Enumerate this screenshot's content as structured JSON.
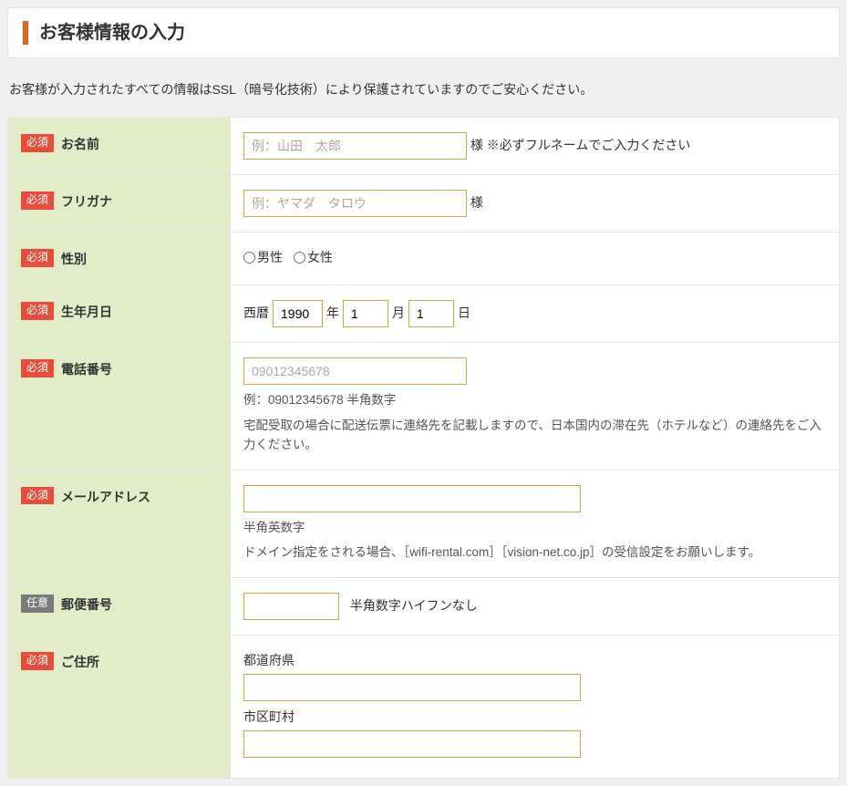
{
  "header": {
    "title": "お客様情報の入力"
  },
  "ssl_notice": "お客様が入力されたすべての情報はSSL（暗号化技術）により保護されていますのでご安心ください。",
  "badges": {
    "required": "必須",
    "optional": "任意"
  },
  "fields": {
    "name": {
      "label": "お名前",
      "placeholder": "例：山田　太郎",
      "suffix": "様 ※必ずフルネームでご入力ください"
    },
    "furigana": {
      "label": "フリガナ",
      "placeholder": "例：ヤマダ　タロウ",
      "suffix": "様"
    },
    "gender": {
      "label": "性別",
      "male": "男性",
      "female": "女性"
    },
    "birth": {
      "label": "生年月日",
      "prefix": "西暦",
      "year": "1990",
      "year_suffix": "年",
      "month": "1",
      "month_suffix": "月",
      "day": "1",
      "day_suffix": "日"
    },
    "phone": {
      "label": "電話番号",
      "placeholder": "09012345678",
      "help1": "例：09012345678 半角数字",
      "help2": "宅配受取の場合に配送伝票に連絡先を記載しますので、日本国内の滞在先（ホテルなど）の連絡先をご入力ください。"
    },
    "email": {
      "label": "メールアドレス",
      "help1": "半角英数字",
      "help2": "ドメイン指定をされる場合、［wifi-rental.com］［vision-net.co.jp］の受信設定をお願いします。"
    },
    "postal": {
      "label": "郵便番号",
      "suffix": "半角数字ハイフンなし"
    },
    "address": {
      "label": "ご住所",
      "pref": "都道府県",
      "city": "市区町村"
    }
  }
}
